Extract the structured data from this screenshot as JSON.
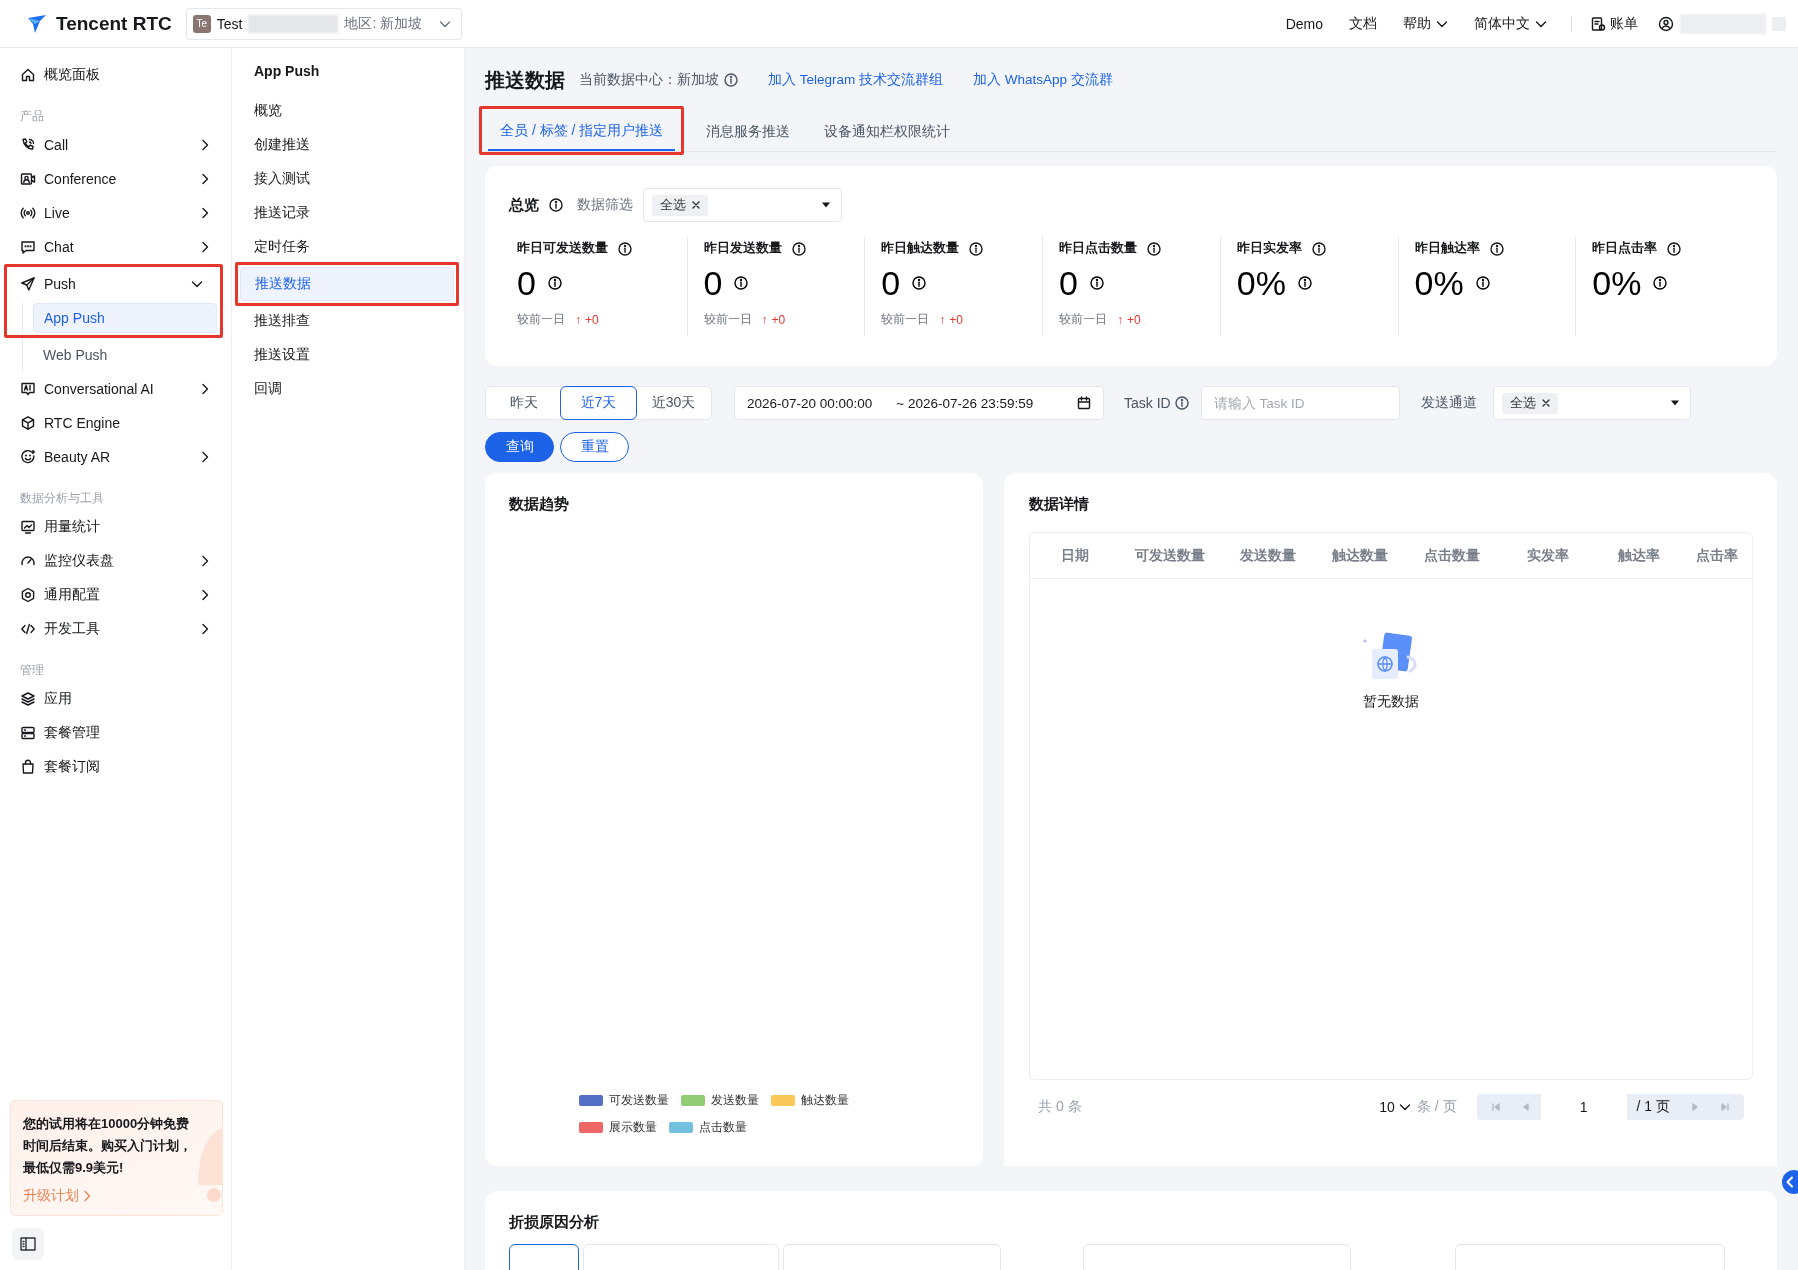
{
  "topbar": {
    "brand": "Tencent RTC",
    "project": {
      "badge": "Te",
      "name": "Test",
      "region": "地区: 新加坡"
    },
    "links": [
      {
        "label": "Demo",
        "dropdown": false
      },
      {
        "label": "文档",
        "dropdown": false
      },
      {
        "label": "帮助",
        "dropdown": true
      },
      {
        "label": "简体中文",
        "dropdown": true
      }
    ],
    "billing": "账单"
  },
  "sidebar": {
    "sections": [
      {
        "items": [
          {
            "label": "概览面板",
            "selected": false
          }
        ]
      },
      {
        "heading": "产品",
        "items": [
          {
            "label": "Call",
            "expanded": false,
            "selected": false
          },
          {
            "label": "Conference",
            "expanded": false,
            "selected": false
          },
          {
            "label": "Live",
            "expanded": false,
            "selected": false
          },
          {
            "label": "Chat",
            "expanded": false,
            "selected": false
          },
          {
            "label": "Push",
            "expanded": true,
            "selected": false,
            "highlighted": true,
            "children": [
              {
                "label": "App Push",
                "selected": true,
                "highlighted": true
              },
              {
                "label": "Web Push",
                "selected": false,
                "highlighted": false
              }
            ]
          },
          {
            "label": "Conversational AI",
            "expanded": false,
            "selected": false
          },
          {
            "label": "RTC Engine",
            "selected": false
          },
          {
            "label": "Beauty AR",
            "expanded": false,
            "selected": false
          }
        ]
      },
      {
        "heading": "数据分析与工具",
        "items": [
          {
            "label": "用量统计",
            "selected": false
          },
          {
            "label": "监控仪表盘",
            "expanded": false,
            "selected": false
          },
          {
            "label": "通用配置",
            "expanded": false,
            "selected": false
          },
          {
            "label": "开发工具",
            "expanded": false,
            "selected": false
          }
        ]
      },
      {
        "heading": "管理",
        "items": [
          {
            "label": "应用",
            "selected": false
          },
          {
            "label": "套餐管理",
            "selected": false
          },
          {
            "label": "套餐订阅",
            "selected": false
          }
        ]
      }
    ],
    "promo": {
      "text": "您的试用将在10000分钟免费时间后结束。购买入门计划，最低仅需9.9美元!",
      "link": "升级计划"
    }
  },
  "subnav": {
    "title": "App Push",
    "items": [
      {
        "label": "概览",
        "selected": false,
        "highlighted": false
      },
      {
        "label": "创建推送",
        "selected": false,
        "highlighted": false
      },
      {
        "label": "接入测试",
        "selected": false,
        "highlighted": false
      },
      {
        "label": "推送记录",
        "selected": false,
        "highlighted": false
      },
      {
        "label": "定时任务",
        "selected": false,
        "highlighted": false
      },
      {
        "label": "推送数据",
        "selected": true,
        "highlighted": true
      },
      {
        "label": "推送排查",
        "selected": false,
        "highlighted": false
      },
      {
        "label": "推送设置",
        "selected": false,
        "highlighted": false
      },
      {
        "label": "回调",
        "selected": false,
        "highlighted": false
      }
    ]
  },
  "page": {
    "title": "推送数据",
    "data_center": "当前数据中心：新加坡",
    "links": [
      "加入 Telegram 技术交流群组",
      "加入 WhatsApp 交流群"
    ]
  },
  "tabs": [
    {
      "label": "全员 / 标签 / 指定用户推送",
      "selected": true,
      "highlighted": true
    },
    {
      "label": "消息服务推送",
      "selected": false,
      "highlighted": false
    },
    {
      "label": "设备通知栏权限统计",
      "selected": false,
      "highlighted": false
    }
  ],
  "overview": {
    "title": "总览",
    "filter_label": "数据筛选",
    "filter_tag": "全选",
    "metrics": [
      {
        "label": "昨日可发送数量",
        "value": "0",
        "compare": "较前一日",
        "arrow": "↑",
        "delta": "+0"
      },
      {
        "label": "昨日发送数量",
        "value": "0",
        "compare": "较前一日",
        "arrow": "↑",
        "delta": "+0"
      },
      {
        "label": "昨日触达数量",
        "value": "0",
        "compare": "较前一日",
        "arrow": "↑",
        "delta": "+0"
      },
      {
        "label": "昨日点击数量",
        "value": "0",
        "compare": "较前一日",
        "arrow": "↑",
        "delta": "+0"
      },
      {
        "label": "昨日实发率",
        "value": "0%"
      },
      {
        "label": "昨日触达率",
        "value": "0%"
      },
      {
        "label": "昨日点击率",
        "value": "0%"
      }
    ]
  },
  "filters": {
    "ranges": [
      {
        "label": "昨天",
        "selected": false
      },
      {
        "label": "近7天",
        "selected": true
      },
      {
        "label": "近30天",
        "selected": false
      }
    ],
    "date_start": "2026-07-20 00:00:00",
    "date_end": "~ 2026-07-26 23:59:59",
    "task_label": "Task ID",
    "task_placeholder": "请输入 Task ID",
    "channel_label": "发送通道",
    "channel_tag": "全选",
    "buttons": [
      {
        "label": "查询",
        "kind": "primary"
      },
      {
        "label": "重置",
        "kind": "secondary"
      }
    ]
  },
  "trend": {
    "title": "数据趋势",
    "legend": [
      {
        "name": "可发送数量",
        "color": "#5470c6"
      },
      {
        "name": "发送数量",
        "color": "#91cc75"
      },
      {
        "name": "触达数量",
        "color": "#fac858"
      },
      {
        "name": "展示数量",
        "color": "#ee6666"
      },
      {
        "name": "点击数量",
        "color": "#73c0de"
      }
    ]
  },
  "details": {
    "title": "数据详情",
    "columns": [
      "日期",
      "可发送数量",
      "发送数量",
      "触达数量",
      "点击数量",
      "实发率",
      "触达率",
      "点击率"
    ],
    "empty": "暂无数据",
    "total": "共 0 条",
    "page_size": "10",
    "page_size_unit": "条 / 页",
    "page": "1",
    "pages": "/ 1 页"
  },
  "loss": {
    "title": "折损原因分析"
  }
}
